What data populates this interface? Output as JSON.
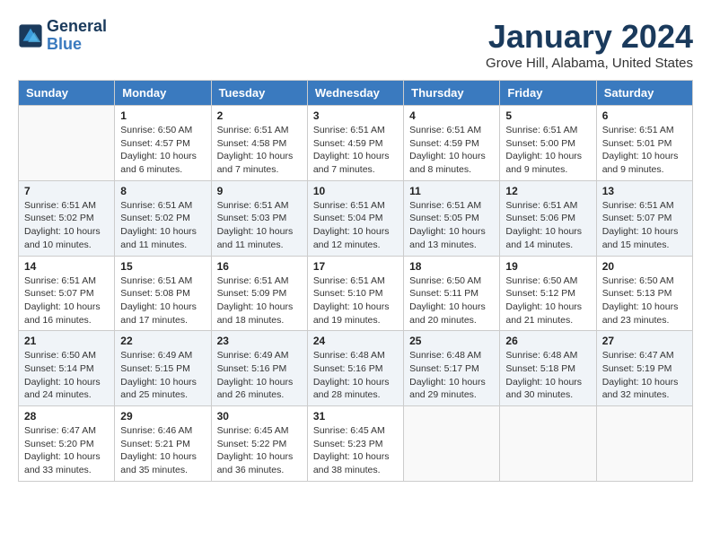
{
  "logo": {
    "line1": "General",
    "line2": "Blue"
  },
  "title": "January 2024",
  "subtitle": "Grove Hill, Alabama, United States",
  "days_of_week": [
    "Sunday",
    "Monday",
    "Tuesday",
    "Wednesday",
    "Thursday",
    "Friday",
    "Saturday"
  ],
  "weeks": [
    [
      {
        "day": "",
        "info": ""
      },
      {
        "day": "1",
        "info": "Sunrise: 6:50 AM\nSunset: 4:57 PM\nDaylight: 10 hours\nand 6 minutes."
      },
      {
        "day": "2",
        "info": "Sunrise: 6:51 AM\nSunset: 4:58 PM\nDaylight: 10 hours\nand 7 minutes."
      },
      {
        "day": "3",
        "info": "Sunrise: 6:51 AM\nSunset: 4:59 PM\nDaylight: 10 hours\nand 7 minutes."
      },
      {
        "day": "4",
        "info": "Sunrise: 6:51 AM\nSunset: 4:59 PM\nDaylight: 10 hours\nand 8 minutes."
      },
      {
        "day": "5",
        "info": "Sunrise: 6:51 AM\nSunset: 5:00 PM\nDaylight: 10 hours\nand 9 minutes."
      },
      {
        "day": "6",
        "info": "Sunrise: 6:51 AM\nSunset: 5:01 PM\nDaylight: 10 hours\nand 9 minutes."
      }
    ],
    [
      {
        "day": "7",
        "info": "Sunrise: 6:51 AM\nSunset: 5:02 PM\nDaylight: 10 hours\nand 10 minutes."
      },
      {
        "day": "8",
        "info": "Sunrise: 6:51 AM\nSunset: 5:02 PM\nDaylight: 10 hours\nand 11 minutes."
      },
      {
        "day": "9",
        "info": "Sunrise: 6:51 AM\nSunset: 5:03 PM\nDaylight: 10 hours\nand 11 minutes."
      },
      {
        "day": "10",
        "info": "Sunrise: 6:51 AM\nSunset: 5:04 PM\nDaylight: 10 hours\nand 12 minutes."
      },
      {
        "day": "11",
        "info": "Sunrise: 6:51 AM\nSunset: 5:05 PM\nDaylight: 10 hours\nand 13 minutes."
      },
      {
        "day": "12",
        "info": "Sunrise: 6:51 AM\nSunset: 5:06 PM\nDaylight: 10 hours\nand 14 minutes."
      },
      {
        "day": "13",
        "info": "Sunrise: 6:51 AM\nSunset: 5:07 PM\nDaylight: 10 hours\nand 15 minutes."
      }
    ],
    [
      {
        "day": "14",
        "info": "Sunrise: 6:51 AM\nSunset: 5:07 PM\nDaylight: 10 hours\nand 16 minutes."
      },
      {
        "day": "15",
        "info": "Sunrise: 6:51 AM\nSunset: 5:08 PM\nDaylight: 10 hours\nand 17 minutes."
      },
      {
        "day": "16",
        "info": "Sunrise: 6:51 AM\nSunset: 5:09 PM\nDaylight: 10 hours\nand 18 minutes."
      },
      {
        "day": "17",
        "info": "Sunrise: 6:51 AM\nSunset: 5:10 PM\nDaylight: 10 hours\nand 19 minutes."
      },
      {
        "day": "18",
        "info": "Sunrise: 6:50 AM\nSunset: 5:11 PM\nDaylight: 10 hours\nand 20 minutes."
      },
      {
        "day": "19",
        "info": "Sunrise: 6:50 AM\nSunset: 5:12 PM\nDaylight: 10 hours\nand 21 minutes."
      },
      {
        "day": "20",
        "info": "Sunrise: 6:50 AM\nSunset: 5:13 PM\nDaylight: 10 hours\nand 23 minutes."
      }
    ],
    [
      {
        "day": "21",
        "info": "Sunrise: 6:50 AM\nSunset: 5:14 PM\nDaylight: 10 hours\nand 24 minutes."
      },
      {
        "day": "22",
        "info": "Sunrise: 6:49 AM\nSunset: 5:15 PM\nDaylight: 10 hours\nand 25 minutes."
      },
      {
        "day": "23",
        "info": "Sunrise: 6:49 AM\nSunset: 5:16 PM\nDaylight: 10 hours\nand 26 minutes."
      },
      {
        "day": "24",
        "info": "Sunrise: 6:48 AM\nSunset: 5:16 PM\nDaylight: 10 hours\nand 28 minutes."
      },
      {
        "day": "25",
        "info": "Sunrise: 6:48 AM\nSunset: 5:17 PM\nDaylight: 10 hours\nand 29 minutes."
      },
      {
        "day": "26",
        "info": "Sunrise: 6:48 AM\nSunset: 5:18 PM\nDaylight: 10 hours\nand 30 minutes."
      },
      {
        "day": "27",
        "info": "Sunrise: 6:47 AM\nSunset: 5:19 PM\nDaylight: 10 hours\nand 32 minutes."
      }
    ],
    [
      {
        "day": "28",
        "info": "Sunrise: 6:47 AM\nSunset: 5:20 PM\nDaylight: 10 hours\nand 33 minutes."
      },
      {
        "day": "29",
        "info": "Sunrise: 6:46 AM\nSunset: 5:21 PM\nDaylight: 10 hours\nand 35 minutes."
      },
      {
        "day": "30",
        "info": "Sunrise: 6:45 AM\nSunset: 5:22 PM\nDaylight: 10 hours\nand 36 minutes."
      },
      {
        "day": "31",
        "info": "Sunrise: 6:45 AM\nSunset: 5:23 PM\nDaylight: 10 hours\nand 38 minutes."
      },
      {
        "day": "",
        "info": ""
      },
      {
        "day": "",
        "info": ""
      },
      {
        "day": "",
        "info": ""
      }
    ]
  ]
}
